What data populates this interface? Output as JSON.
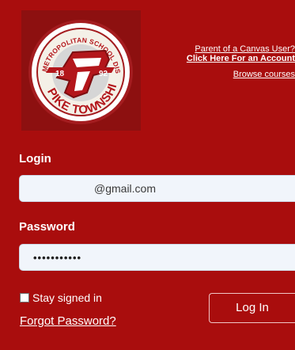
{
  "logo": {
    "top_text": "METROPOLITAN SCHOOL DISTRICT OF",
    "bottom_text": "PIKE TOWNSHIP",
    "year_left": "18",
    "year_right": "92",
    "letter": "P"
  },
  "links": {
    "parent_line1": "Parent of a Canvas User?",
    "parent_line2": "Click Here For an Account",
    "browse": "Browse courses"
  },
  "form": {
    "login_label": "Login",
    "login_value": "@gmail.com",
    "password_label": "Password",
    "password_value": "•••••••••••",
    "stay_signed_in": "Stay signed in",
    "stay_signed_in_checked": false,
    "forgot_password": "Forgot Password?",
    "login_button": "Log In"
  },
  "colors": {
    "background": "#a90d0d",
    "logo_panel": "#8d1010",
    "seal_red": "#b3161b",
    "field_bg": "#f1f5fb",
    "text": "#ffffff"
  }
}
